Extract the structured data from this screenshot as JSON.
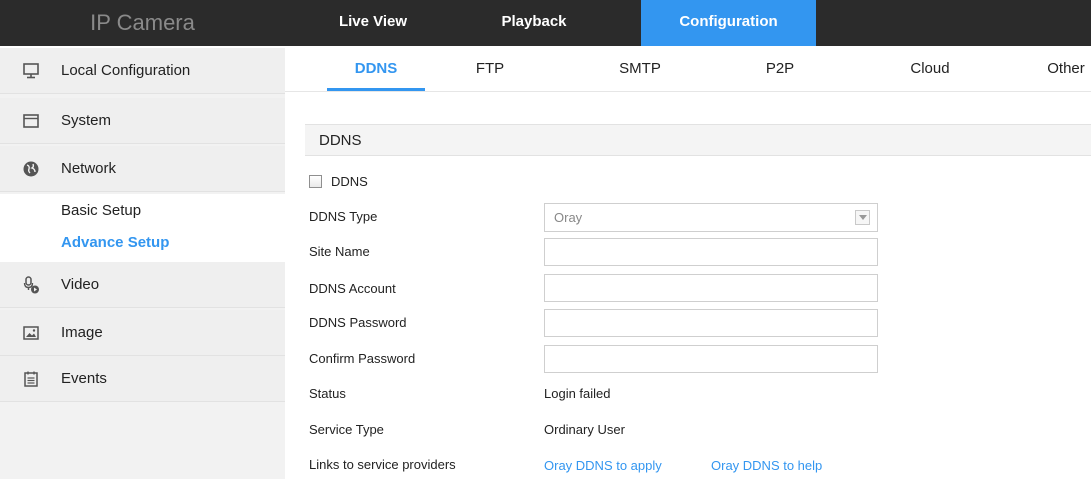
{
  "app": {
    "title": "IP Camera"
  },
  "top_nav": {
    "tabs": [
      {
        "label": "Live View"
      },
      {
        "label": "Playback"
      },
      {
        "label": "Configuration"
      }
    ],
    "active": "Configuration"
  },
  "sidebar": {
    "items": [
      {
        "label": "Local Configuration",
        "icon": "monitor-icon"
      },
      {
        "label": "System",
        "icon": "window-icon"
      },
      {
        "label": "Network",
        "icon": "globe-icon"
      },
      {
        "label": "Video",
        "icon": "video-mic-icon"
      },
      {
        "label": "Image",
        "icon": "image-icon"
      },
      {
        "label": "Events",
        "icon": "calendar-icon"
      }
    ],
    "network_sub": [
      {
        "label": "Basic Setup"
      },
      {
        "label": "Advance Setup"
      }
    ],
    "active_sub": "Advance Setup"
  },
  "sub_tabs": {
    "tabs": [
      {
        "label": "DDNS"
      },
      {
        "label": "FTP"
      },
      {
        "label": "SMTP"
      },
      {
        "label": "P2P"
      },
      {
        "label": "Cloud"
      },
      {
        "label": "Other"
      }
    ],
    "active": "DDNS"
  },
  "ddns": {
    "section_title": "DDNS",
    "enable_label": "DDNS",
    "enabled": false,
    "fields": {
      "type_label": "DDNS Type",
      "type_value": "Oray",
      "site_name_label": "Site Name",
      "site_name_value": "",
      "account_label": "DDNS Account",
      "account_value": "",
      "password_label": "DDNS Password",
      "password_value": "",
      "confirm_label": "Confirm Password",
      "confirm_value": "",
      "status_label": "Status",
      "status_value": "Login failed",
      "service_type_label": "Service Type",
      "service_type_value": "Ordinary User",
      "links_label": "Links to service providers",
      "link_apply": "Oray DDNS to apply",
      "link_help": "Oray DDNS to help"
    }
  },
  "colors": {
    "accent": "#3396f0",
    "topbar": "#2b2b2b",
    "sidebar": "#efefef"
  }
}
